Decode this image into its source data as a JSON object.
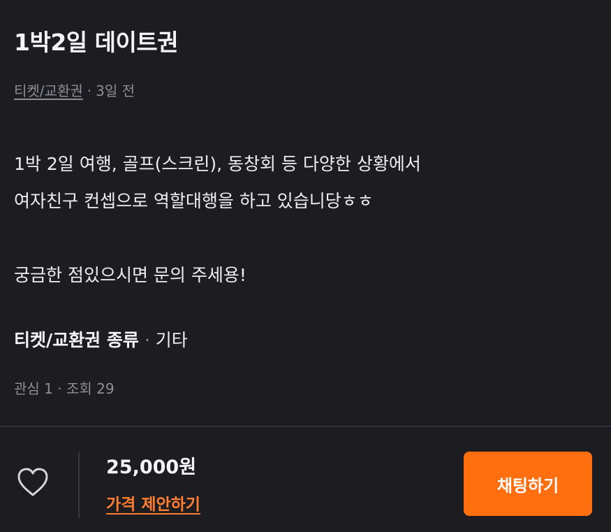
{
  "post": {
    "title": "1박2일 데이트권",
    "category": "티켓/교환권",
    "time_ago": "3일 전",
    "description_lines": [
      "1박 2일 여행, 골프(스크린), 동창회 등 다양한 상황에서",
      "여자친구 컨셉으로 역할대행을 하고 있습니당ㅎㅎ",
      "",
      "궁금한 점있으시면 문의 주세용!"
    ],
    "type_label": "티켓/교환권 종류",
    "type_value": "기타",
    "stats": "관심 1 · 조회 29"
  },
  "bottom_bar": {
    "like_icon": "heart-outline-icon",
    "price": "25,000원",
    "offer_label": "가격 제안하기",
    "chat_label": "채팅하기"
  },
  "colors": {
    "background": "#1d1d21",
    "accent": "#ff6f0f",
    "offer_text": "#ff7e2f",
    "muted_text": "#8d8f97"
  }
}
